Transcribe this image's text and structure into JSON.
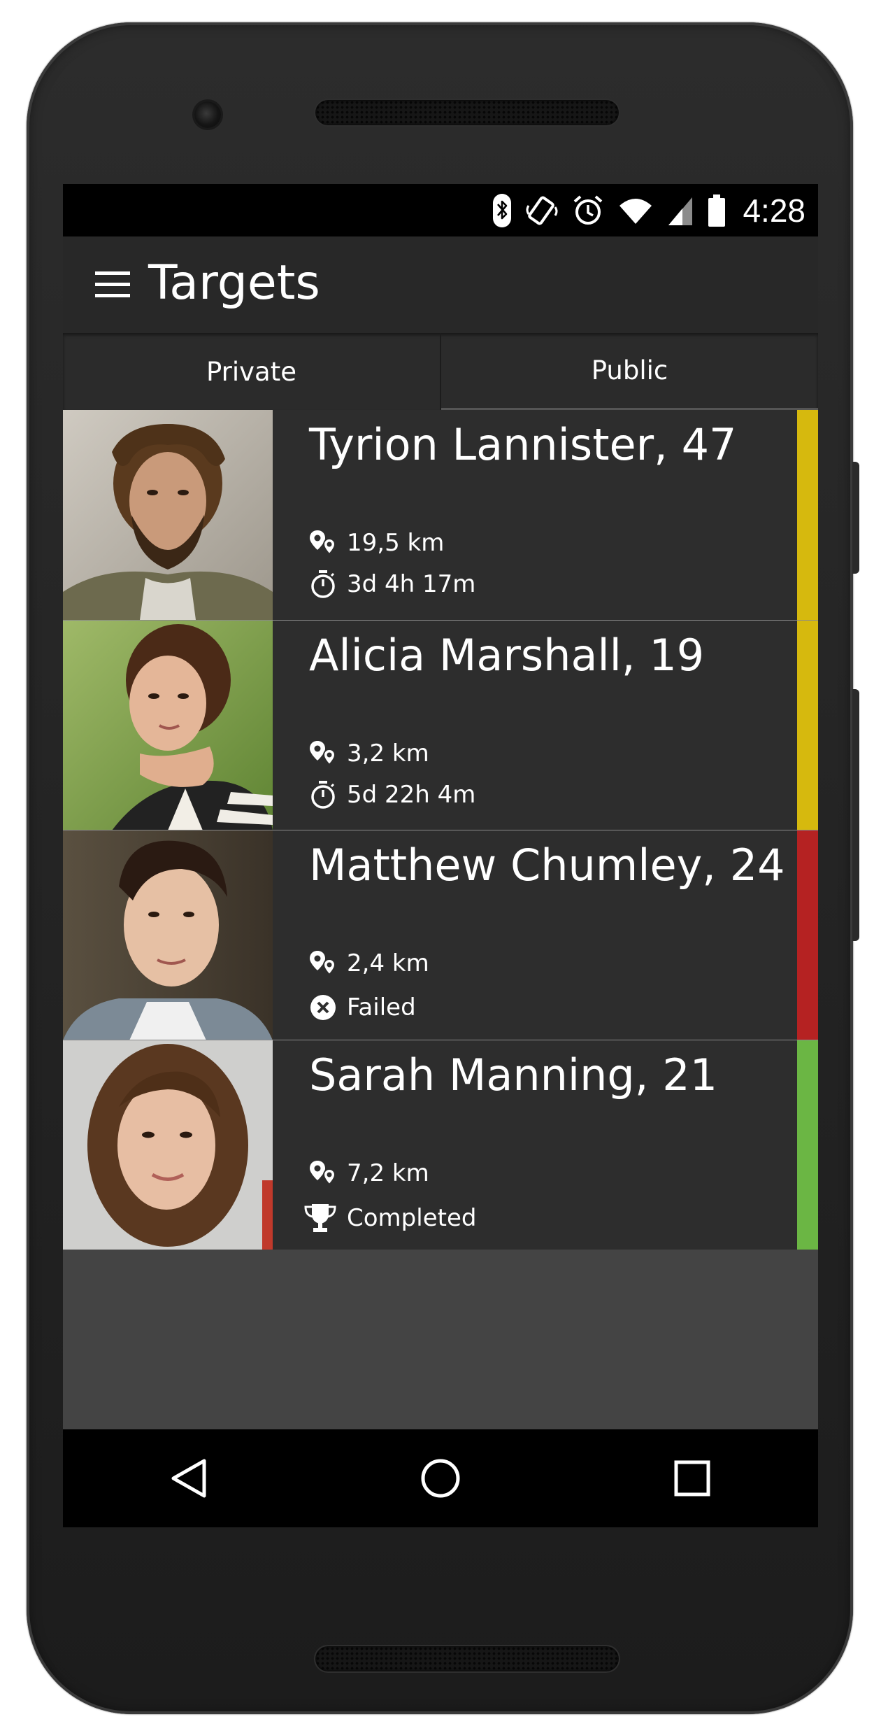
{
  "status_bar": {
    "time": "4:28",
    "icons": [
      "bluetooth-icon",
      "vibrate-icon",
      "alarm-icon",
      "wifi-icon",
      "cell-signal-icon",
      "battery-icon"
    ]
  },
  "app_bar": {
    "title": "Targets",
    "menu_icon": "hamburger-menu-icon"
  },
  "tabs": [
    {
      "label": "Private",
      "selected": true
    },
    {
      "label": "Public",
      "selected": false
    }
  ],
  "targets": [
    {
      "name": "Tyrion Lannister, 47",
      "distance": "19,5 km",
      "detail_icon": "timer-icon",
      "detail": "3d 4h 17m",
      "status_color": "#d6b90e"
    },
    {
      "name": "Alicia Marshall, 19",
      "distance": "3,2 km",
      "detail_icon": "timer-icon",
      "detail": "5d 22h 4m",
      "status_color": "#d6b90e"
    },
    {
      "name": "Matthew Chumley, 24",
      "distance": "2,4 km",
      "detail_icon": "failed-icon",
      "detail": "Failed",
      "status_color": "#b52222"
    },
    {
      "name": "Sarah Manning, 21",
      "distance": "7,2 km",
      "detail_icon": "trophy-icon",
      "detail": "Completed",
      "status_color": "#6bb644"
    }
  ],
  "nav_bar": {
    "icons": [
      "back-icon",
      "home-icon",
      "recents-icon"
    ]
  },
  "colors": {
    "status_pending": "#d6b90e",
    "status_failed": "#b52222",
    "status_completed": "#6bb644",
    "app_bar_bg": "#282828",
    "list_bg": "#2d2d2d"
  }
}
